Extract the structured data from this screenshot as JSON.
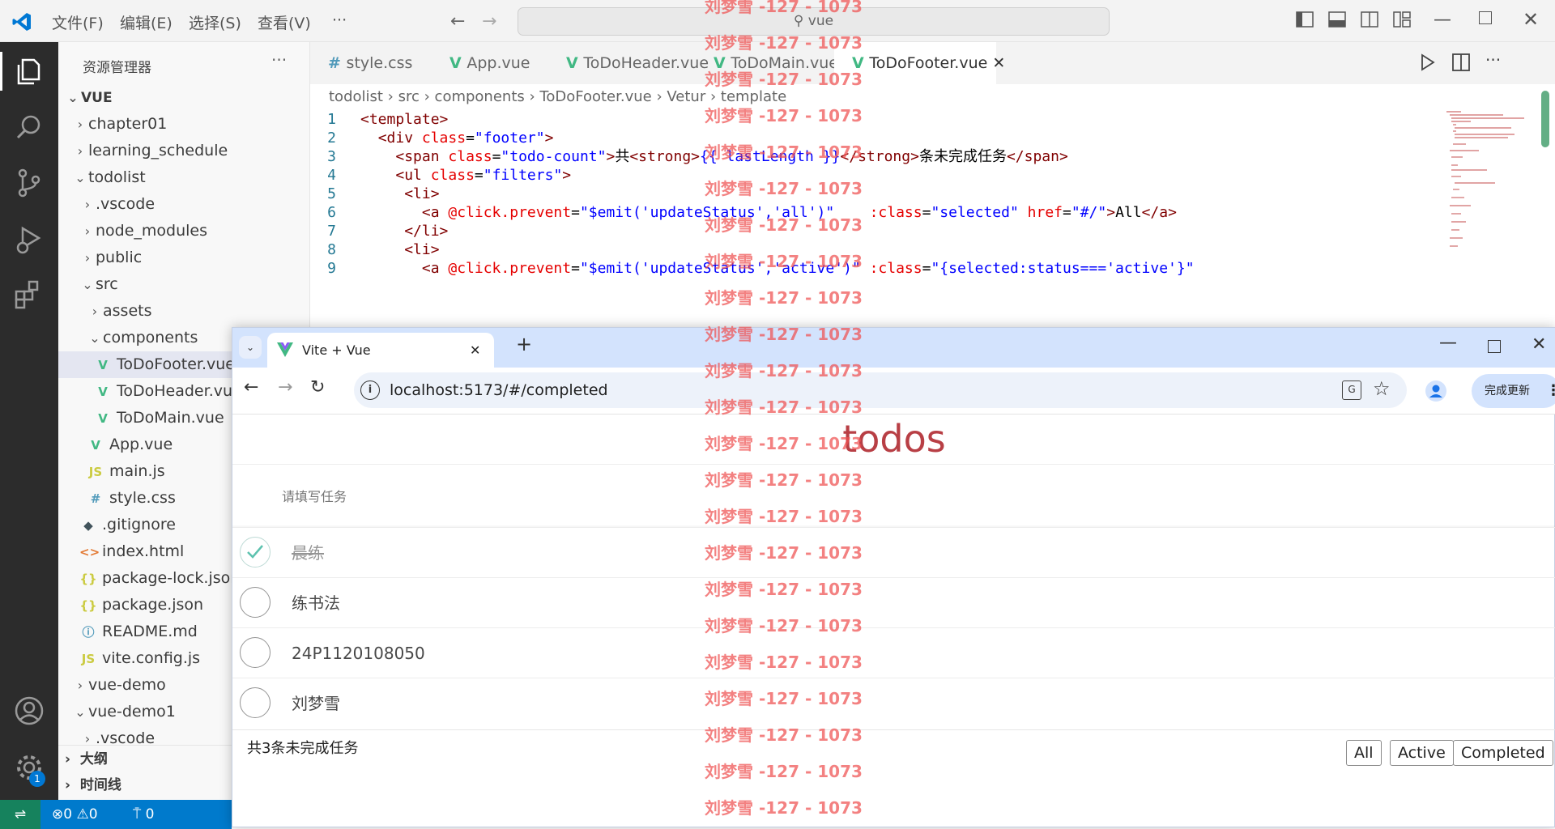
{
  "titlebar": {
    "menu": [
      "文件(F)",
      "编辑(E)",
      "选择(S)",
      "查看(V)",
      "···"
    ],
    "search": "vue"
  },
  "sidebar": {
    "title": "资源管理器",
    "more": "···",
    "root": "VUE",
    "items": [
      {
        "label": "chapter01",
        "indent": 1,
        "chev": "›",
        "icon": ""
      },
      {
        "label": "learning_schedule",
        "indent": 1,
        "chev": "›",
        "icon": ""
      },
      {
        "label": "todolist",
        "indent": 1,
        "chev": "⌄",
        "icon": ""
      },
      {
        "label": ".vscode",
        "indent": 2,
        "chev": "›",
        "icon": ""
      },
      {
        "label": "node_modules",
        "indent": 2,
        "chev": "›",
        "icon": ""
      },
      {
        "label": "public",
        "indent": 2,
        "chev": "›",
        "icon": ""
      },
      {
        "label": "src",
        "indent": 2,
        "chev": "⌄",
        "icon": ""
      },
      {
        "label": "assets",
        "indent": 3,
        "chev": "›",
        "icon": ""
      },
      {
        "label": "components",
        "indent": 3,
        "chev": "⌄",
        "icon": ""
      },
      {
        "label": "ToDoFooter.vue",
        "indent": 4,
        "chev": "",
        "icon": "vue",
        "selected": true
      },
      {
        "label": "ToDoHeader.vue",
        "indent": 4,
        "chev": "",
        "icon": "vue"
      },
      {
        "label": "ToDoMain.vue",
        "indent": 4,
        "chev": "",
        "icon": "vue"
      },
      {
        "label": "App.vue",
        "indent": 3,
        "chev": "",
        "icon": "vue"
      },
      {
        "label": "main.js",
        "indent": 3,
        "chev": "",
        "icon": "js"
      },
      {
        "label": "style.css",
        "indent": 3,
        "chev": "",
        "icon": "css"
      },
      {
        "label": ".gitignore",
        "indent": 2,
        "chev": "",
        "icon": "git"
      },
      {
        "label": "index.html",
        "indent": 2,
        "chev": "",
        "icon": "html"
      },
      {
        "label": "package-lock.json",
        "indent": 2,
        "chev": "",
        "icon": "json"
      },
      {
        "label": "package.json",
        "indent": 2,
        "chev": "",
        "icon": "json"
      },
      {
        "label": "README.md",
        "indent": 2,
        "chev": "",
        "icon": "info"
      },
      {
        "label": "vite.config.js",
        "indent": 2,
        "chev": "",
        "icon": "js"
      },
      {
        "label": "vue-demo",
        "indent": 1,
        "chev": "›",
        "icon": ""
      },
      {
        "label": "vue-demo1",
        "indent": 1,
        "chev": "⌄",
        "icon": ""
      },
      {
        "label": ".vscode",
        "indent": 2,
        "chev": "›",
        "icon": ""
      }
    ],
    "outline": "大纲",
    "timeline": "时间线"
  },
  "editor": {
    "tabs": [
      {
        "label": "style.css",
        "icon": "css"
      },
      {
        "label": "App.vue",
        "icon": "vue"
      },
      {
        "label": "ToDoHeader.vue",
        "icon": "vue"
      },
      {
        "label": "ToDoMain.vue",
        "icon": "vue"
      },
      {
        "label": "ToDoFooter.vue",
        "icon": "vue",
        "active": true
      }
    ],
    "breadcrumb": [
      "todolist",
      "src",
      "components",
      "ToDoFooter.vue",
      "Vetur",
      "template"
    ],
    "lines": [
      {
        "n": "1",
        "indent": "",
        "html": [
          [
            "t-tag",
            "<template>"
          ]
        ]
      },
      {
        "n": "2",
        "indent": "  ",
        "html": [
          [
            "t-tag",
            "<div "
          ],
          [
            "t-attr",
            "class"
          ],
          [
            "t-txt",
            "="
          ],
          [
            "t-str",
            "\"footer\""
          ],
          [
            "t-tag",
            ">"
          ]
        ]
      },
      {
        "n": "3",
        "indent": "    ",
        "html": [
          [
            "t-tag",
            "<span "
          ],
          [
            "t-attr",
            "class"
          ],
          [
            "t-txt",
            "="
          ],
          [
            "t-str",
            "\"todo-count\""
          ],
          [
            "t-tag",
            ">"
          ],
          [
            "t-txt",
            "共"
          ],
          [
            "t-tag",
            "<strong>"
          ],
          [
            "t-str",
            "{{ lastLength }}"
          ],
          [
            "t-tag",
            "</strong>"
          ],
          [
            "t-txt",
            "条未完成任务"
          ],
          [
            "t-tag",
            "</span>"
          ]
        ]
      },
      {
        "n": "4",
        "indent": "    ",
        "html": [
          [
            "t-tag",
            "<ul "
          ],
          [
            "t-attr",
            "class"
          ],
          [
            "t-txt",
            "="
          ],
          [
            "t-str",
            "\"filters\""
          ],
          [
            "t-tag",
            ">"
          ]
        ]
      },
      {
        "n": "5",
        "indent": "     ",
        "html": [
          [
            "t-tag",
            "<li>"
          ]
        ]
      },
      {
        "n": "6",
        "indent": "       ",
        "html": [
          [
            "t-tag",
            "<a "
          ],
          [
            "t-attr",
            "@click.prevent"
          ],
          [
            "t-txt",
            "="
          ],
          [
            "t-str",
            "\"$emit('updateStatus','all')\""
          ],
          [
            "t-txt",
            "    "
          ],
          [
            "t-attr",
            ":class"
          ],
          [
            "t-txt",
            "="
          ],
          [
            "t-str",
            "\"selected\""
          ],
          [
            "t-txt",
            " "
          ],
          [
            "t-attr",
            "href"
          ],
          [
            "t-txt",
            "="
          ],
          [
            "t-str",
            "\"#/\""
          ],
          [
            "t-tag",
            ">"
          ],
          [
            "t-txt",
            "All"
          ],
          [
            "t-tag",
            "</a>"
          ]
        ]
      },
      {
        "n": "7",
        "indent": "     ",
        "html": [
          [
            "t-tag",
            "</li>"
          ]
        ]
      },
      {
        "n": "8",
        "indent": "     ",
        "html": [
          [
            "t-tag",
            "<li>"
          ]
        ]
      },
      {
        "n": "9",
        "indent": "       ",
        "html": [
          [
            "t-tag",
            "<a "
          ],
          [
            "t-attr",
            "@click.prevent"
          ],
          [
            "t-txt",
            "="
          ],
          [
            "t-str",
            "\"$emit('updateStatus','active')\""
          ],
          [
            "t-txt",
            " "
          ],
          [
            "t-attr",
            ":class"
          ],
          [
            "t-txt",
            "="
          ],
          [
            "t-str",
            "\"{selected:status==='active'}\""
          ]
        ]
      }
    ]
  },
  "browser": {
    "tab_title": "Vite + Vue",
    "url": "localhost:5173/#/completed",
    "update_label": "完成更新"
  },
  "todo": {
    "title": "todos",
    "placeholder": "请填写任务",
    "items": [
      {
        "text": "晨练",
        "completed": true
      },
      {
        "text": "练书法",
        "completed": false
      },
      {
        "text": "24P1120108050",
        "completed": false
      },
      {
        "text": "刘梦雪",
        "completed": false
      }
    ],
    "count_text": "共3条未完成任务",
    "filters": [
      "All",
      "Active",
      "Completed"
    ]
  },
  "status": {
    "errors": "0",
    "warnings": "0",
    "ports": "0",
    "notifications": "1"
  },
  "watermark": "刘梦雪 -127 - 1073",
  "colors": {
    "accent": "#007acc",
    "todo_title": "#b83f45",
    "completed_check": "#5dc2af"
  }
}
